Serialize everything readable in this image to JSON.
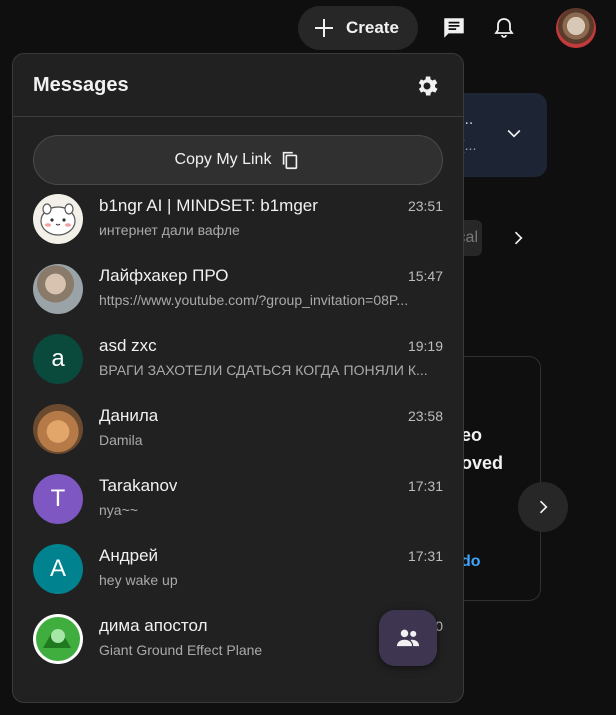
{
  "topbar": {
    "create_label": "Create",
    "icons": [
      "plus-icon",
      "messages-icon",
      "bell-icon",
      "avatar"
    ]
  },
  "background": {
    "card1_dots": "...",
    "card1_sub": "(...",
    "chip_text": "cal",
    "card2_line1": "eo",
    "card2_line2": "oved",
    "card2_link": "do"
  },
  "messages": {
    "title": "Messages",
    "copy_link_label": "Copy My Link",
    "chats": [
      {
        "name": "b1ngr AI | MINDSET: b1mger",
        "preview": "интернет дали вафле",
        "time": "23:51",
        "avatar_letter": "",
        "avatar_color": "#f3efe9"
      },
      {
        "name": "Лайфхакер ПРО",
        "preview": "https://www.youtube.com/?group_invitation=08P...",
        "time": "15:47",
        "avatar_letter": "",
        "avatar_color": "#9aa3a8"
      },
      {
        "name": "asd zxc",
        "preview": "ВРАГИ ЗАХОТЕЛИ СДАТЬСЯ КОГДА ПОНЯЛИ К...",
        "time": "19:19",
        "avatar_letter": "a",
        "avatar_color": "#0a4a3c"
      },
      {
        "name": "Данила",
        "preview": "Damila",
        "time": "23:58",
        "avatar_letter": "",
        "avatar_color": "#b57a47"
      },
      {
        "name": "Tarakanov",
        "preview": "nya~~",
        "time": "17:31",
        "avatar_letter": "T",
        "avatar_color": "#7e57c2"
      },
      {
        "name": "Андрей",
        "preview": "hey wake up",
        "time": "17:31",
        "avatar_letter": "A",
        "avatar_color": "#00838f"
      },
      {
        "name": "дима апостол",
        "preview": "Giant Ground Effect Plane",
        "time": "0",
        "avatar_letter": "",
        "avatar_color": "#3fae3f"
      }
    ]
  },
  "colors": {
    "page_bg": "#0f0f0f",
    "panel_bg": "#212121",
    "link_blue": "#3ea6ff"
  }
}
